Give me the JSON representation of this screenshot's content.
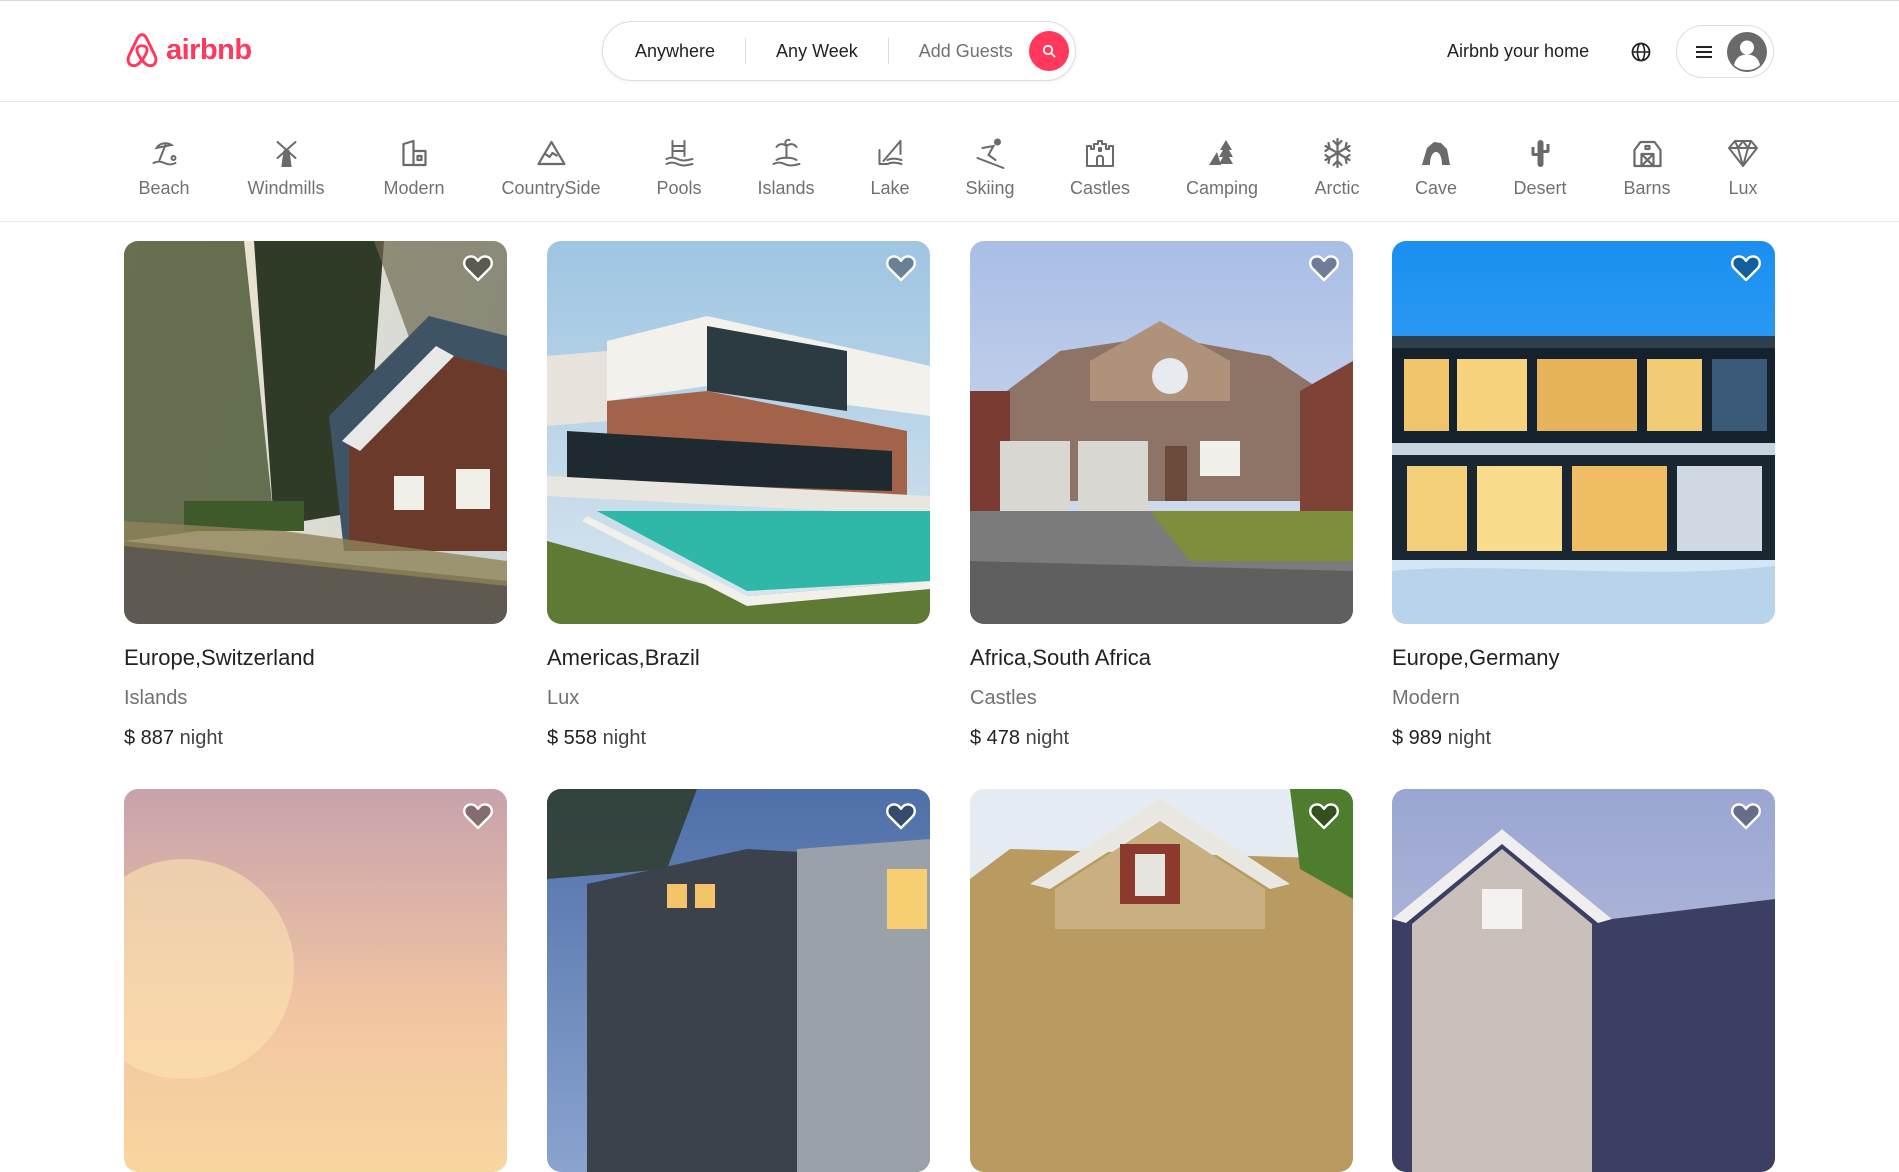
{
  "brand": {
    "name": "airbnb",
    "color": "#ff385c"
  },
  "search": {
    "location": "Anywhere",
    "week": "Any Week",
    "guests": "Add Guests",
    "button_icon": "search-icon"
  },
  "header": {
    "host_link": "Airbnb your home",
    "globe_icon": "globe-icon",
    "menu_icon": "menu-icon",
    "avatar_icon": "avatar-icon"
  },
  "categories": [
    {
      "label": "Beach",
      "icon": "beach-icon"
    },
    {
      "label": "Windmills",
      "icon": "windmill-icon"
    },
    {
      "label": "Modern",
      "icon": "modern-icon"
    },
    {
      "label": "CountrySide",
      "icon": "mountain-icon"
    },
    {
      "label": "Pools",
      "icon": "pool-icon"
    },
    {
      "label": "Islands",
      "icon": "island-icon"
    },
    {
      "label": "Lake",
      "icon": "lake-icon"
    },
    {
      "label": "Skiing",
      "icon": "skiing-icon"
    },
    {
      "label": "Castles",
      "icon": "castle-icon"
    },
    {
      "label": "Camping",
      "icon": "camping-icon"
    },
    {
      "label": "Arctic",
      "icon": "snowflake-icon"
    },
    {
      "label": "Cave",
      "icon": "cave-icon"
    },
    {
      "label": "Desert",
      "icon": "cactus-icon"
    },
    {
      "label": "Barns",
      "icon": "barn-icon"
    },
    {
      "label": "Lux",
      "icon": "diamond-icon"
    }
  ],
  "listings": [
    {
      "location": "Europe,Switzerland",
      "category": "Islands",
      "price": "$ 887",
      "unit": "night"
    },
    {
      "location": "Americas,Brazil",
      "category": "Lux",
      "price": "$ 558",
      "unit": "night"
    },
    {
      "location": "Africa,South Africa",
      "category": "Castles",
      "price": "$ 478",
      "unit": "night"
    },
    {
      "location": "Europe,Germany",
      "category": "Modern",
      "price": "$ 989",
      "unit": "night"
    },
    {
      "location": "",
      "category": "",
      "price": "",
      "unit": ""
    },
    {
      "location": "",
      "category": "",
      "price": "",
      "unit": ""
    },
    {
      "location": "",
      "category": "",
      "price": "",
      "unit": ""
    },
    {
      "location": "",
      "category": "",
      "price": "",
      "unit": ""
    }
  ]
}
